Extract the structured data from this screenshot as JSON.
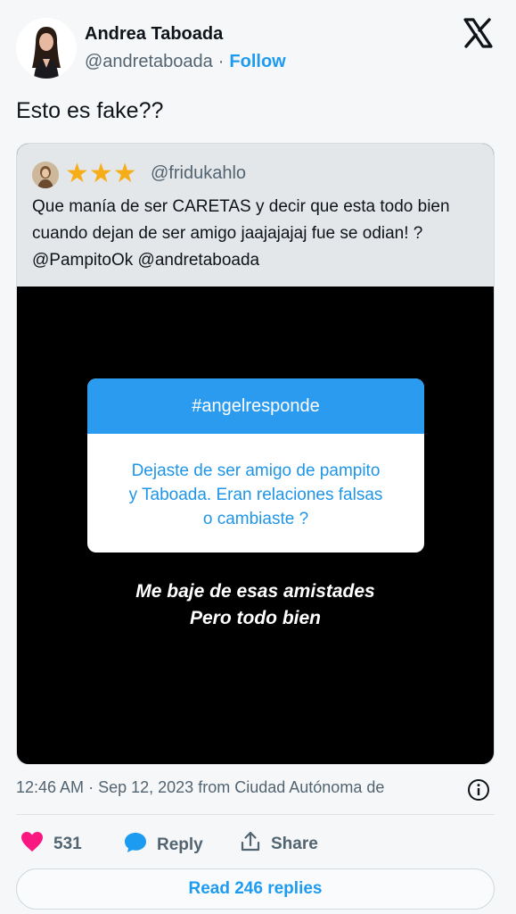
{
  "author": {
    "name": "Andrea Taboada",
    "handle": "@andretaboada",
    "separator": "·",
    "follow_label": "Follow"
  },
  "tweet": {
    "text": "Esto es fake??"
  },
  "quote": {
    "stars": "★★★",
    "handle": "@fridukahlo",
    "text": "Que manía de ser CARETAS y decir que esta todo bien cuando dejan de ser amigo jaajajajaj fue se odian! ? @PampitoOk @andretaboada",
    "story": {
      "tag": "#angelresponde",
      "question_line1": "Dejaste de ser amigo de pampito",
      "question_line2": "y Taboada. Eran relaciones falsas",
      "question_line3": "o cambiaste ?",
      "answer_line1": "Me baje de esas amistades",
      "answer_line2": "Pero todo bien"
    }
  },
  "meta": {
    "time": "12:46 AM",
    "separator": "·",
    "date": "Sep 12, 2023",
    "location": "from Ciudad Autónoma de"
  },
  "actions": {
    "like_count": "531",
    "reply_label": "Reply",
    "share_label": "Share",
    "read_replies_label": "Read 246 replies"
  },
  "icons": {
    "logo": "x-logo-icon",
    "like": "heart-icon",
    "reply": "speech-bubble-icon",
    "share": "share-upload-icon",
    "info": "info-icon"
  },
  "colors": {
    "accent": "#1d9bf0",
    "like": "#f91880",
    "story_header": "#2b9bf0",
    "stars": "#f6ad1a"
  }
}
